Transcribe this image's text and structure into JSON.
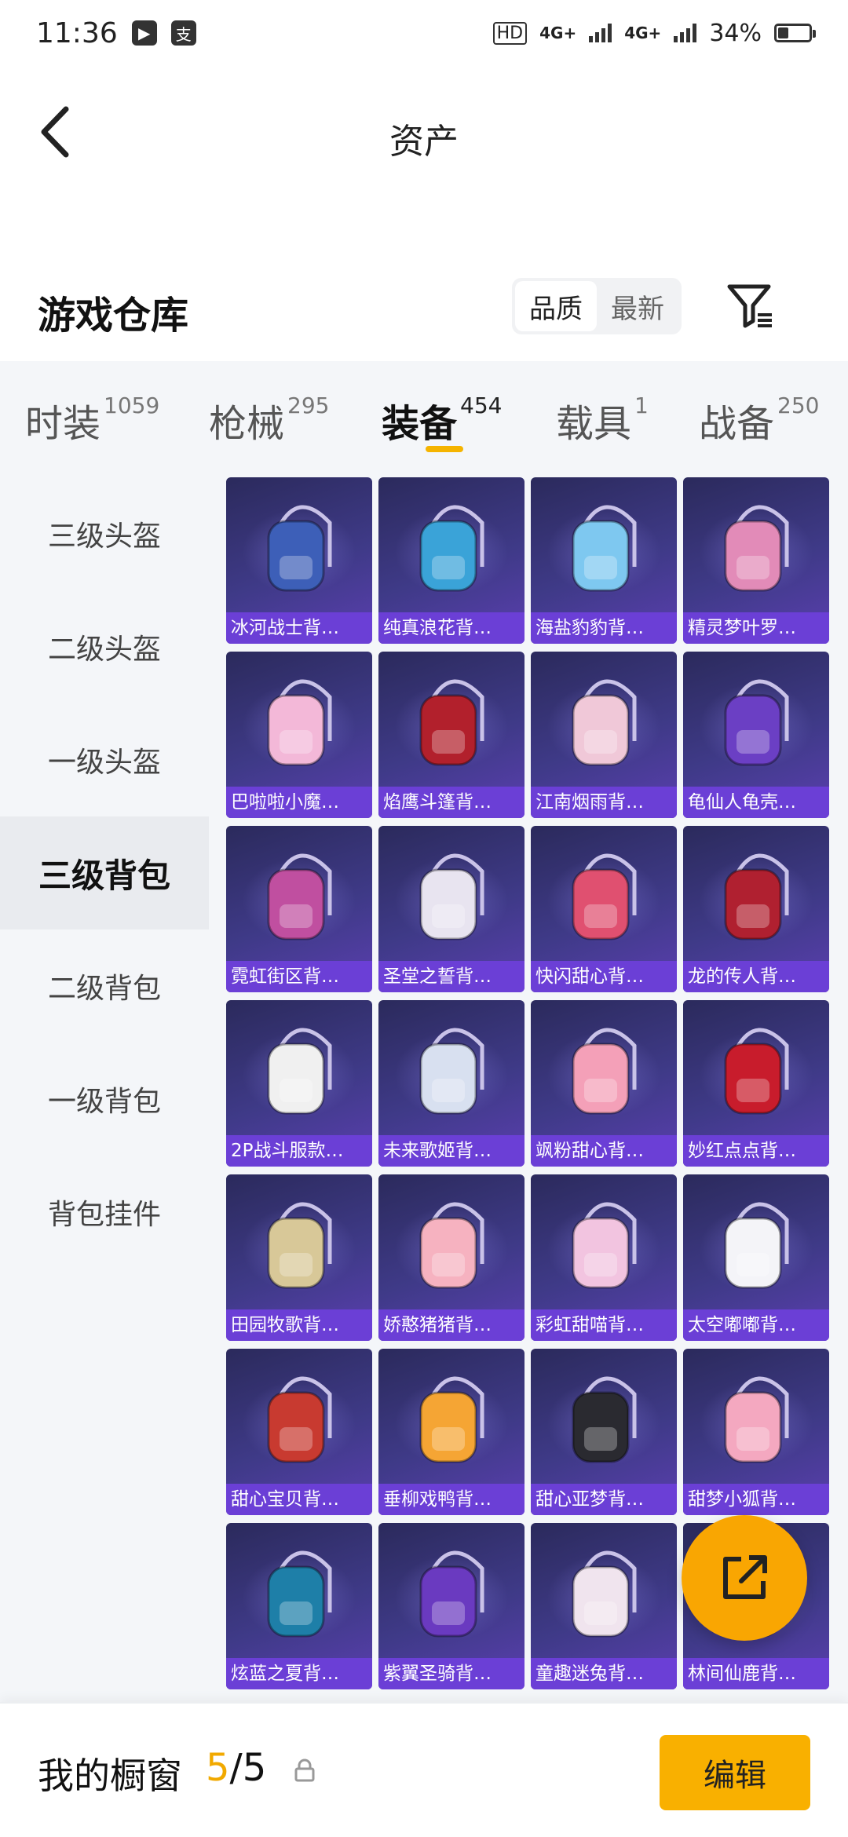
{
  "status_bar": {
    "time": "11:36",
    "network1": "4G+",
    "network2": "4G+",
    "hd": "HD",
    "battery": "34%",
    "battery_level": 0.34
  },
  "header": {
    "title": "资产"
  },
  "section": {
    "title": "游戏仓库",
    "sort_options": [
      "品质",
      "最新"
    ],
    "sort_selected": "品质"
  },
  "tabs": [
    {
      "label": "时装",
      "count": "1059"
    },
    {
      "label": "枪械",
      "count": "295"
    },
    {
      "label": "装备",
      "count": "454"
    },
    {
      "label": "载具",
      "count": "1"
    },
    {
      "label": "战备",
      "count": "250"
    }
  ],
  "active_tab": "装备",
  "sidebar": {
    "items": [
      "三级头盔",
      "二级头盔",
      "一级头盔",
      "三级背包",
      "二级背包",
      "一级背包",
      "背包挂件"
    ],
    "active": "三级背包"
  },
  "items": [
    {
      "name": "冰河战士背…",
      "color": "#3d5fb8"
    },
    {
      "name": "纯真浪花背…",
      "color": "#3aa3d8"
    },
    {
      "name": "海盐豹豹背…",
      "color": "#7ec8f0"
    },
    {
      "name": "精灵梦叶罗…",
      "color": "#e28bb8"
    },
    {
      "name": "巴啦啦小魔…",
      "color": "#f3b8d8"
    },
    {
      "name": "焰鹰斗篷背…",
      "color": "#b2202c"
    },
    {
      "name": "江南烟雨背…",
      "color": "#f0c8d8"
    },
    {
      "name": "龟仙人龟壳…",
      "color": "#6b3fc4"
    },
    {
      "name": "霓虹街区背…",
      "color": "#c04fa0"
    },
    {
      "name": "圣堂之誓背…",
      "color": "#e8e4f0"
    },
    {
      "name": "快闪甜心背…",
      "color": "#e05070"
    },
    {
      "name": "龙的传人背…",
      "color": "#b02030"
    },
    {
      "name": "2P战斗服款…",
      "color": "#f0f0f0"
    },
    {
      "name": "未来歌姬背…",
      "color": "#d8e0f0"
    },
    {
      "name": "飒粉甜心背…",
      "color": "#f4a0b8"
    },
    {
      "name": "妙红点点背…",
      "color": "#c81c2c"
    },
    {
      "name": "田园牧歌背…",
      "color": "#d8c898"
    },
    {
      "name": "娇憨猪猪背…",
      "color": "#f6b2c0"
    },
    {
      "name": "彩虹甜喵背…",
      "color": "#f2c4e0"
    },
    {
      "name": "太空嘟嘟背…",
      "color": "#f4f4f8"
    },
    {
      "name": "甜心宝贝背…",
      "color": "#c83a30"
    },
    {
      "name": "垂柳戏鸭背…",
      "color": "#f5a534"
    },
    {
      "name": "甜心亚梦背…",
      "color": "#2a2a30"
    },
    {
      "name": "甜梦小狐背…",
      "color": "#f4a8c0"
    },
    {
      "name": "炫蓝之夏背…",
      "color": "#1e7fa8"
    },
    {
      "name": "紫翼圣骑背…",
      "color": "#6a3ac0"
    },
    {
      "name": "童趣迷兔背…",
      "color": "#f0e4ee"
    },
    {
      "name": "林间仙鹿背…",
      "color": "#c89a6a"
    }
  ],
  "bottom_bar": {
    "label": "我的橱窗",
    "count_current": "5",
    "count_separator": "/",
    "count_total": "5",
    "edit_label": "编辑"
  },
  "colors": {
    "accent": "#f9b000",
    "card_label": "#6b3fd6"
  }
}
